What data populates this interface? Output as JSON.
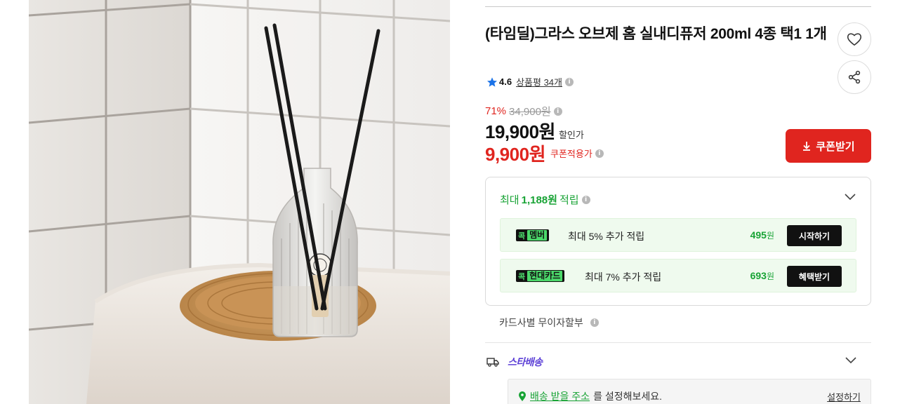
{
  "product": {
    "title": "(타임딜)그라스 오브제 홈 실내디퓨저 200ml 4종 택1 1개",
    "image_alt": "GRASSE reed diffuser on woven tray"
  },
  "rating": {
    "score": "4.6",
    "review_label": "상품평 34개"
  },
  "price": {
    "discount_rate": "71%",
    "original": "34,900원",
    "sale": "19,900원",
    "sale_label": "할인가",
    "coupon": "9,900원",
    "coupon_label": "쿠폰적용가",
    "coupon_button": "쿠폰받기"
  },
  "points": {
    "prefix": "최대",
    "amount": "1,188원",
    "suffix": "적립",
    "benefits": [
      {
        "pick": "콕",
        "badge": "멤버",
        "text": "최대 5% 추가 적립",
        "amount": "495",
        "unit": "원",
        "button": "시작하기"
      },
      {
        "pick": "콕",
        "badge": "현대카드",
        "text": "최대 7% 추가 적립",
        "amount": "693",
        "unit": "원",
        "button": "혜택받기"
      }
    ]
  },
  "installment": "카드사별 무이자할부",
  "delivery": {
    "label": "스타배송",
    "address_link": "배송 받을 주소",
    "address_suffix": "를 설정해보세요.",
    "address_action": "설정하기"
  },
  "colors": {
    "accent_red": "#e0251f",
    "point_green": "#18a335",
    "star_blue": "#1b73e8",
    "star_delivery": "#5b3fd6"
  },
  "icons": [
    "heart-icon",
    "share-icon",
    "star-icon",
    "info-icon",
    "download-icon",
    "chevron-down-icon",
    "truck-icon",
    "location-pin-icon"
  ]
}
